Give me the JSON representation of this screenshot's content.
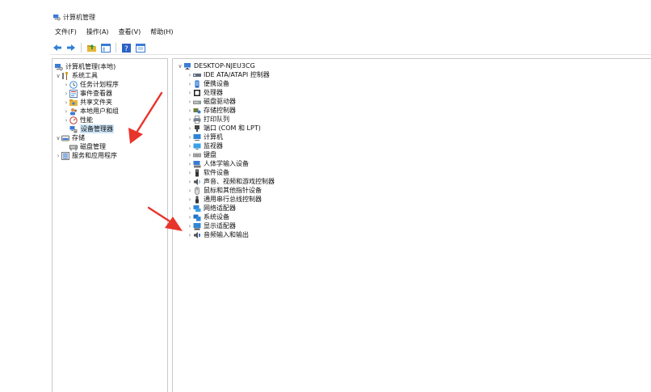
{
  "window": {
    "title": "计算机管理"
  },
  "menu": [
    "文件(F)",
    "操作(A)",
    "查看(V)",
    "帮助(H)"
  ],
  "toolbar": {
    "buttons": [
      "back-icon",
      "forward-icon",
      "up-folder-icon",
      "show-tree-icon",
      "help-icon",
      "properties-icon"
    ]
  },
  "left_tree": {
    "root": "计算机管理(本地)",
    "system_tools": "系统工具",
    "task_scheduler": "任务计划程序",
    "event_viewer": "事件查看器",
    "shared_folders": "共享文件夹",
    "local_users": "本地用户和组",
    "performance": "性能",
    "device_manager": "设备管理器",
    "storage": "存储",
    "disk_management": "磁盘管理",
    "services_apps": "服务和应用程序"
  },
  "device_tree": {
    "computer": "DESKTOP-NJEU3CG",
    "items": [
      "IDE ATA/ATAPI 控制器",
      "便携设备",
      "处理器",
      "磁盘驱动器",
      "存储控制器",
      "打印队列",
      "端口 (COM 和 LPT)",
      "计算机",
      "监视器",
      "键盘",
      "人体学输入设备",
      "软件设备",
      "声音、视频和游戏控制器",
      "鼠标和其他指针设备",
      "通用串行总线控制器",
      "网络适配器",
      "系统设备",
      "显示适配器",
      "音频输入和输出"
    ]
  },
  "colors": {
    "arrow": "#e8352b",
    "selection": "#cce4f7"
  }
}
